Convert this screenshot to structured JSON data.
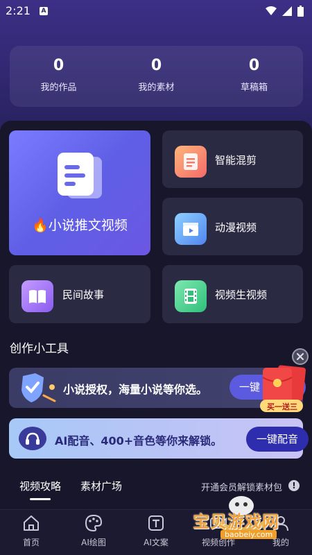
{
  "status": {
    "time": "2:21"
  },
  "stats": [
    {
      "value": "0",
      "label": "我的作品"
    },
    {
      "value": "0",
      "label": "我的素材"
    },
    {
      "value": "0",
      "label": "草稿箱"
    }
  ],
  "features": {
    "big": {
      "label": "🔥小说推文视频"
    },
    "smart_mix": {
      "label": "智能混剪"
    },
    "anime": {
      "label": "动漫视频"
    },
    "folk": {
      "label": "民间故事"
    },
    "video_gen": {
      "label": "视频生视频"
    }
  },
  "tools_title": "创作小工具",
  "banner1": {
    "text": "小说授权，海量小说等你选。",
    "button": "一键"
  },
  "redpack_label": "买一送三",
  "banner2": {
    "text": "AI配音、400+音色等你来解锁。",
    "button": "一键配音"
  },
  "tabs": {
    "active": "视频攻略",
    "other": "素材广场"
  },
  "vip_text": "开通会员解锁素材包",
  "nav": [
    "首页",
    "AI绘图",
    "AI文案",
    "视频创作",
    "我的"
  ],
  "watermark": {
    "text": "宝贝游戏网",
    "url": "baobeiy.com"
  },
  "colors": {
    "accent": "#5f5fe6",
    "panel": "#17162b",
    "card": "#2a2a42"
  }
}
